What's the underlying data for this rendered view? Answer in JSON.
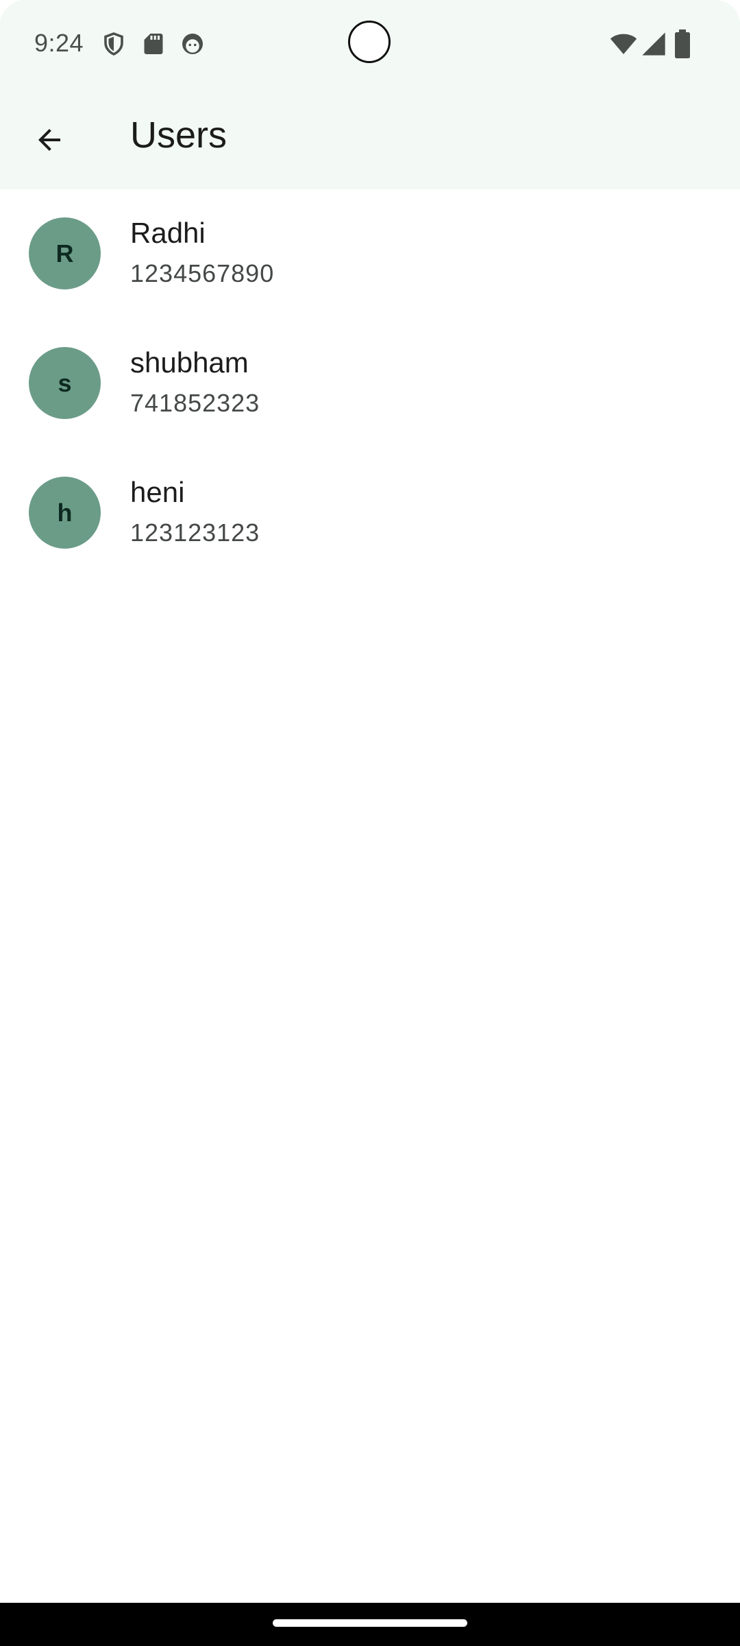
{
  "status_bar": {
    "time": "9:24",
    "left_icons": [
      "shield-icon",
      "sd-card-icon",
      "face-icon"
    ],
    "right_icons": [
      "wifi-icon",
      "signal-icon",
      "battery-icon"
    ]
  },
  "app_bar": {
    "title": "Users",
    "back_icon": "arrow-left-icon"
  },
  "users": [
    {
      "initial": "R",
      "name": "Radhi",
      "phone": "1234567890"
    },
    {
      "initial": "s",
      "name": "shubham",
      "phone": "741852323"
    },
    {
      "initial": "h",
      "name": "heni",
      "phone": "123123123"
    }
  ],
  "colors": {
    "top_bar_bg": "#f3f9f5",
    "avatar_bg": "#6b9c88",
    "avatar_text": "#0d2a20",
    "nav_bar_bg": "#000000"
  }
}
